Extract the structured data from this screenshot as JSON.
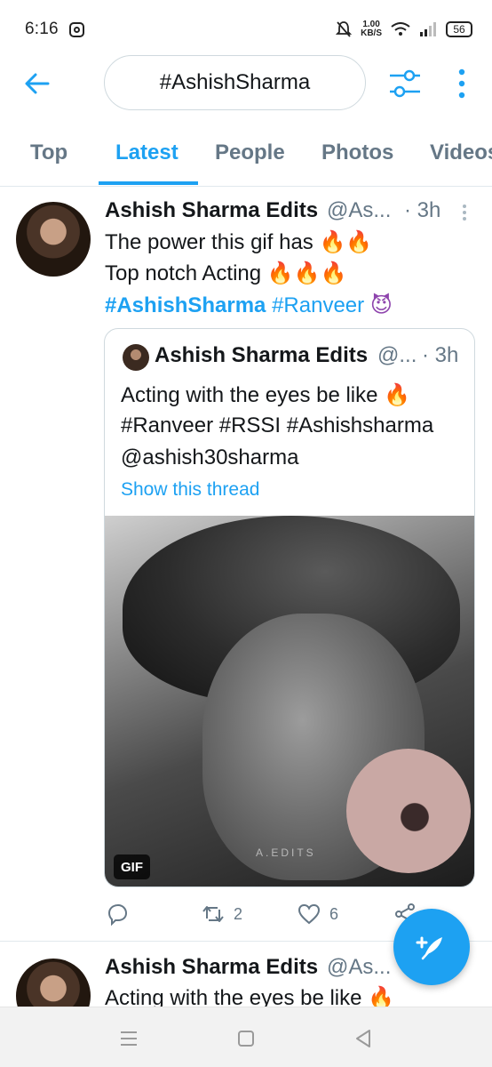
{
  "status_bar": {
    "time": "6:16",
    "net_speed_value": "1.00",
    "net_speed_unit": "KB/S",
    "battery": "56"
  },
  "search": {
    "query": "#AshishSharma"
  },
  "tabs": [
    {
      "label": "Top",
      "active": false
    },
    {
      "label": "Latest",
      "active": true
    },
    {
      "label": "People",
      "active": false
    },
    {
      "label": "Photos",
      "active": false
    },
    {
      "label": "Videos",
      "active": false
    }
  ],
  "tweet": {
    "name": "Ashish Sharma Edits",
    "handle": "@As...",
    "time": "· 3h",
    "line1": "The power this gif has",
    "line1_emoji": "🔥🔥",
    "line2": "Top notch Acting",
    "line2_emoji": "🔥🔥🔥",
    "hashtag1": "#AshishSharma",
    "hashtag2": "#Ranveer",
    "line3_emoji": "😈",
    "quoted": {
      "name": "Ashish Sharma Edits",
      "handle": "@...",
      "time": "· 3h",
      "line1": "Acting with the eyes be like",
      "line1_emoji": "🔥",
      "line2": "#Ranveer #RSSI #Ashishsharma",
      "line3": "@ashish30sharma",
      "show_thread": "Show this thread",
      "gif_badge": "GIF",
      "watermark": "A.EDITS"
    },
    "actions": {
      "retweets": "2",
      "likes": "6"
    }
  },
  "tweet2": {
    "name": "Ashish Sharma Edits",
    "handle": "@As...",
    "line1": "Acting with the eyes be like",
    "line1_emoji": "🔥"
  },
  "colors": {
    "accent": "#1da1f2",
    "muted": "#657786",
    "text": "#14171a"
  }
}
